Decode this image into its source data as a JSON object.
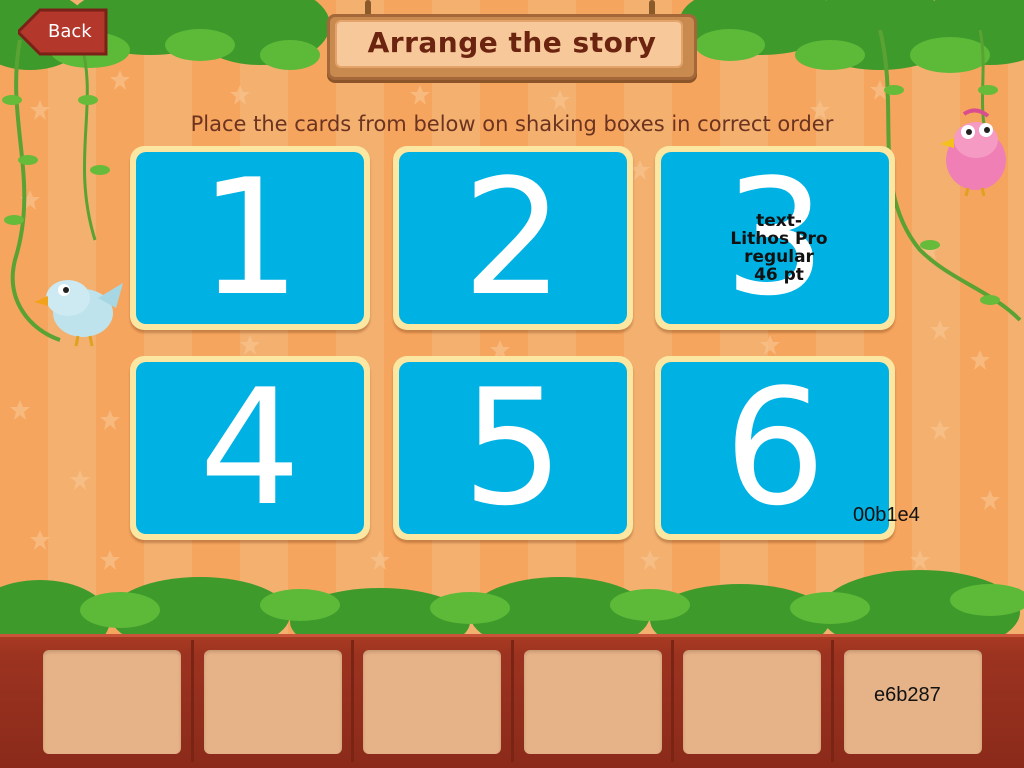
{
  "header": {
    "back_label": "Back",
    "title": "Arrange the story"
  },
  "instruction": "Place the cards from below on shaking boxes in correct order",
  "cards": [
    {
      "number": "1"
    },
    {
      "number": "2"
    },
    {
      "number": "3"
    },
    {
      "number": "4"
    },
    {
      "number": "5"
    },
    {
      "number": "6"
    }
  ],
  "annotations": {
    "font_note": [
      "text-",
      "Lithos Pro",
      "regular",
      "46 pt"
    ],
    "card_color_label": "00b1e4",
    "slot_color_label": "e6b287"
  },
  "tray": {
    "slots": [
      "",
      "",
      "",
      "",
      "",
      "e6b287"
    ]
  },
  "colors": {
    "card_blue": "#00b1e4",
    "slot_tan": "#e6b287",
    "title_text": "#6b2410",
    "back_red": "#b3372a"
  },
  "icons": {
    "blue_bird": "blue-bird-icon",
    "pink_bird": "pink-bird-icon"
  }
}
